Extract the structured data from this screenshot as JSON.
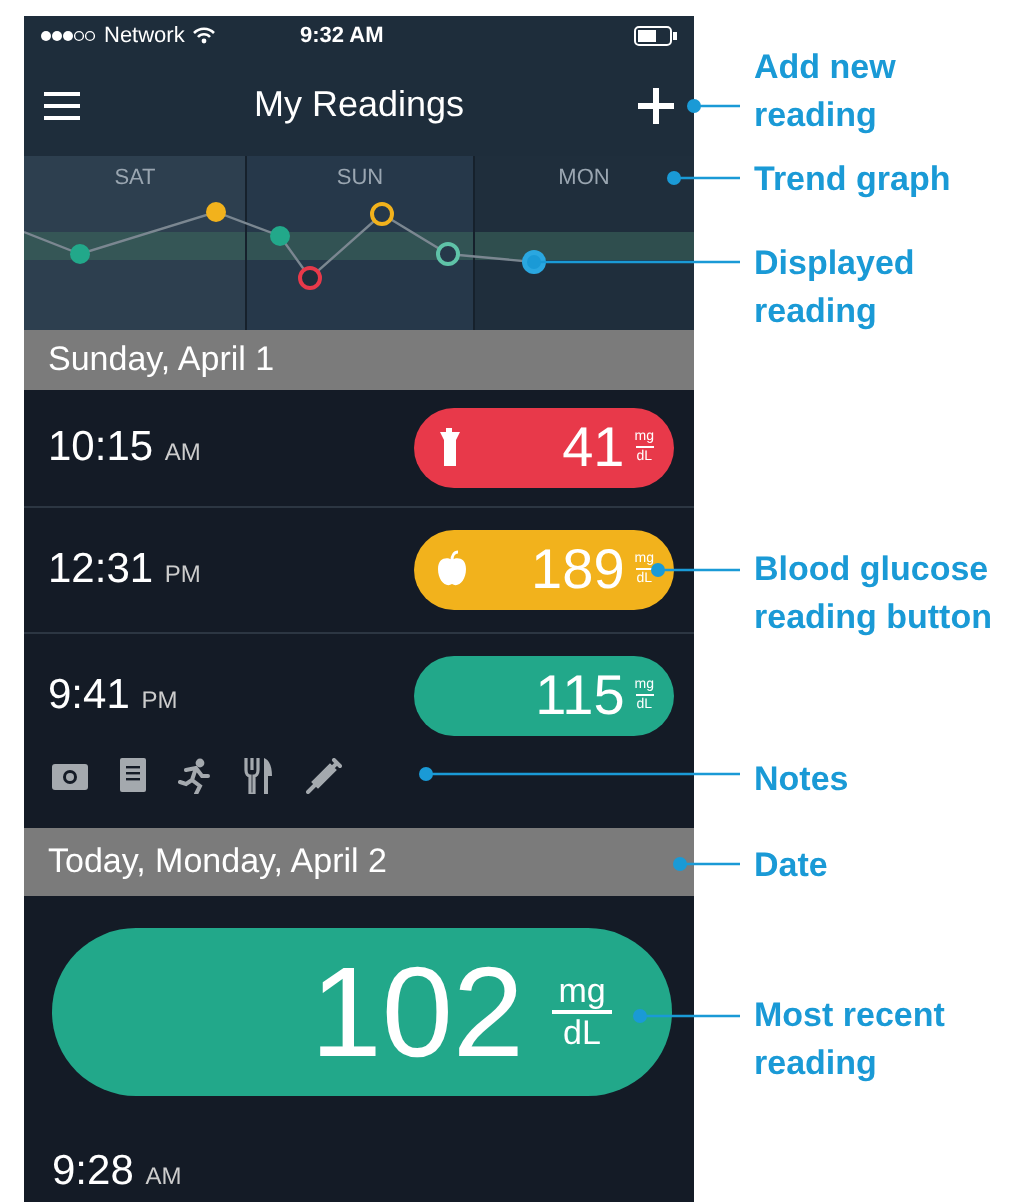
{
  "status_bar": {
    "carrier": "Network",
    "time": "9:32 AM"
  },
  "nav": {
    "title": "My Readings"
  },
  "trend_graph": {
    "days": [
      "SAT",
      "SUN",
      "MON"
    ]
  },
  "sections": [
    {
      "date": "Sunday, April 1",
      "readings": [
        {
          "time": "10:15",
          "period": "AM",
          "value": "41",
          "unit_top": "mg",
          "unit_bottom": "dL",
          "color": "#e8394a",
          "kind": "drink",
          "featured": false
        },
        {
          "time": "12:31",
          "period": "PM",
          "value": "189",
          "unit_top": "mg",
          "unit_bottom": "dL",
          "color": "#f2b21c",
          "kind": "apple",
          "featured": false
        },
        {
          "time": "9:41",
          "period": "PM",
          "value": "115",
          "unit_top": "mg",
          "unit_bottom": "dL",
          "color": "#22a88a",
          "featured": false,
          "notes": [
            {
              "kind": "camera"
            },
            {
              "kind": "document"
            },
            {
              "kind": "running"
            },
            {
              "kind": "utensils"
            },
            {
              "kind": "syringe"
            }
          ]
        }
      ]
    },
    {
      "date": "Today, Monday, April 2",
      "readings": [
        {
          "time": "9:28",
          "period": "AM",
          "value": "102",
          "unit_top": "mg",
          "unit_bottom": "dL",
          "color": "#22a88a",
          "featured": true
        }
      ]
    }
  ],
  "callouts": [
    {
      "lines": [
        "Add new",
        "reading"
      ]
    },
    {
      "lines": [
        "Trend graph"
      ]
    },
    {
      "lines": [
        "Displayed",
        "reading"
      ]
    },
    {
      "lines": [
        "Blood glucose",
        "reading button"
      ]
    },
    {
      "lines": [
        "Notes"
      ]
    },
    {
      "lines": [
        "Date"
      ]
    },
    {
      "lines": [
        "Most recent",
        "reading"
      ]
    }
  ]
}
